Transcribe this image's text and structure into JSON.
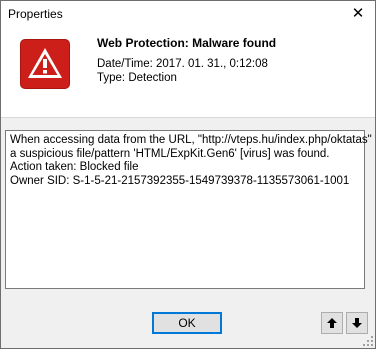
{
  "window": {
    "title": "Properties",
    "close_glyph": "✕"
  },
  "header": {
    "icon": "warning-icon",
    "icon_color": "#cc1f1a",
    "headline": "Web Protection: Malware found",
    "date_line": "Date/Time: 2017. 01. 31., 0:12:08",
    "type_line": "Type: Detection"
  },
  "details": {
    "lines": [
      "When accessing data from the URL, \"http://vteps.hu/index.php/oktatas\"",
      "a suspicious file/pattern 'HTML/ExpKit.Gen6' [virus] was found.",
      "Action taken: Blocked file",
      "Owner SID: S-1-5-21-2157392355-1549739378-1135573061-1001"
    ]
  },
  "buttons": {
    "ok_label": "OK",
    "up_glyph": "🡑",
    "down_glyph": "🡓"
  }
}
